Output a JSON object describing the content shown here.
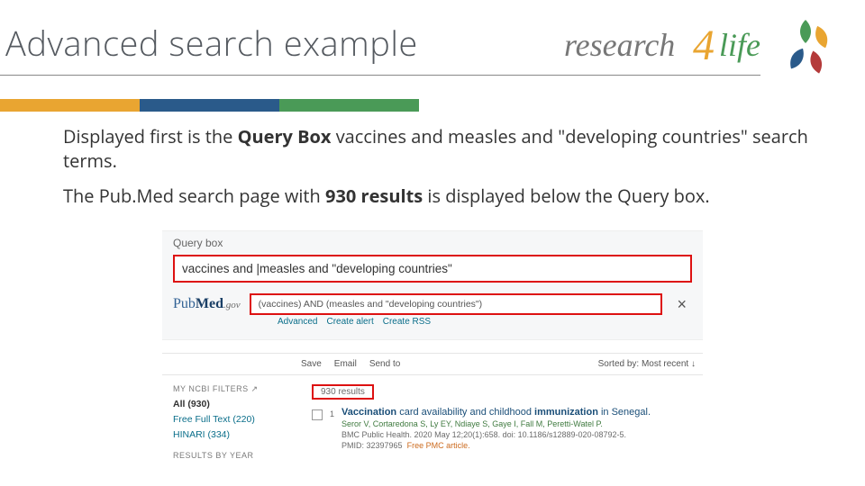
{
  "title": "Advanced search example",
  "logo_text": {
    "research": "research",
    "four": "4",
    "life": "life"
  },
  "para1": {
    "a": "Displayed first is the ",
    "b": "Query Box",
    "c": " vaccines and measles and \"developing countries\" search terms."
  },
  "para2": {
    "a": "The Pub.Med search page with ",
    "b": "930 results",
    "c": " is displayed below the Query box."
  },
  "ss": {
    "query_label": "Query box",
    "query_value": "vaccines and |measles and \"developing countries\"",
    "pubmed": {
      "pub": "Pub",
      "med": "Med",
      "gov": ".gov"
    },
    "query2": "(vaccines) AND (measles and \"developing countries\")",
    "close": "×",
    "sublinks": {
      "adv": "Advanced",
      "alert": "Create alert",
      "rss": "Create RSS"
    },
    "toolbar": {
      "save": "Save",
      "email": "Email",
      "send": "Send to",
      "sort": "Sorted by: Most recent ↓"
    },
    "side": {
      "header1": "MY NCBI FILTERS",
      "ext": "↗",
      "all": "All (930)",
      "fft": "Free Full Text (220)",
      "hin": "HINARI (334)",
      "header2": "RESULTS BY YEAR"
    },
    "results": "930 results",
    "article": {
      "num": "1",
      "title_a": "Vaccination",
      "title_b": " card availability and childhood ",
      "title_c": "immunization",
      "title_d": " in Senegal.",
      "authors": "Seror V, Cortaredona S, Ly EY, Ndiaye S, Gaye I, Fall M, Peretti-Watel P.",
      "journal": "BMC Public Health. 2020 May 12;20(1):658. doi: 10.1186/s12889-020-08792-5.",
      "pmid": "PMID: 32397965",
      "free": "Free PMC article."
    }
  }
}
